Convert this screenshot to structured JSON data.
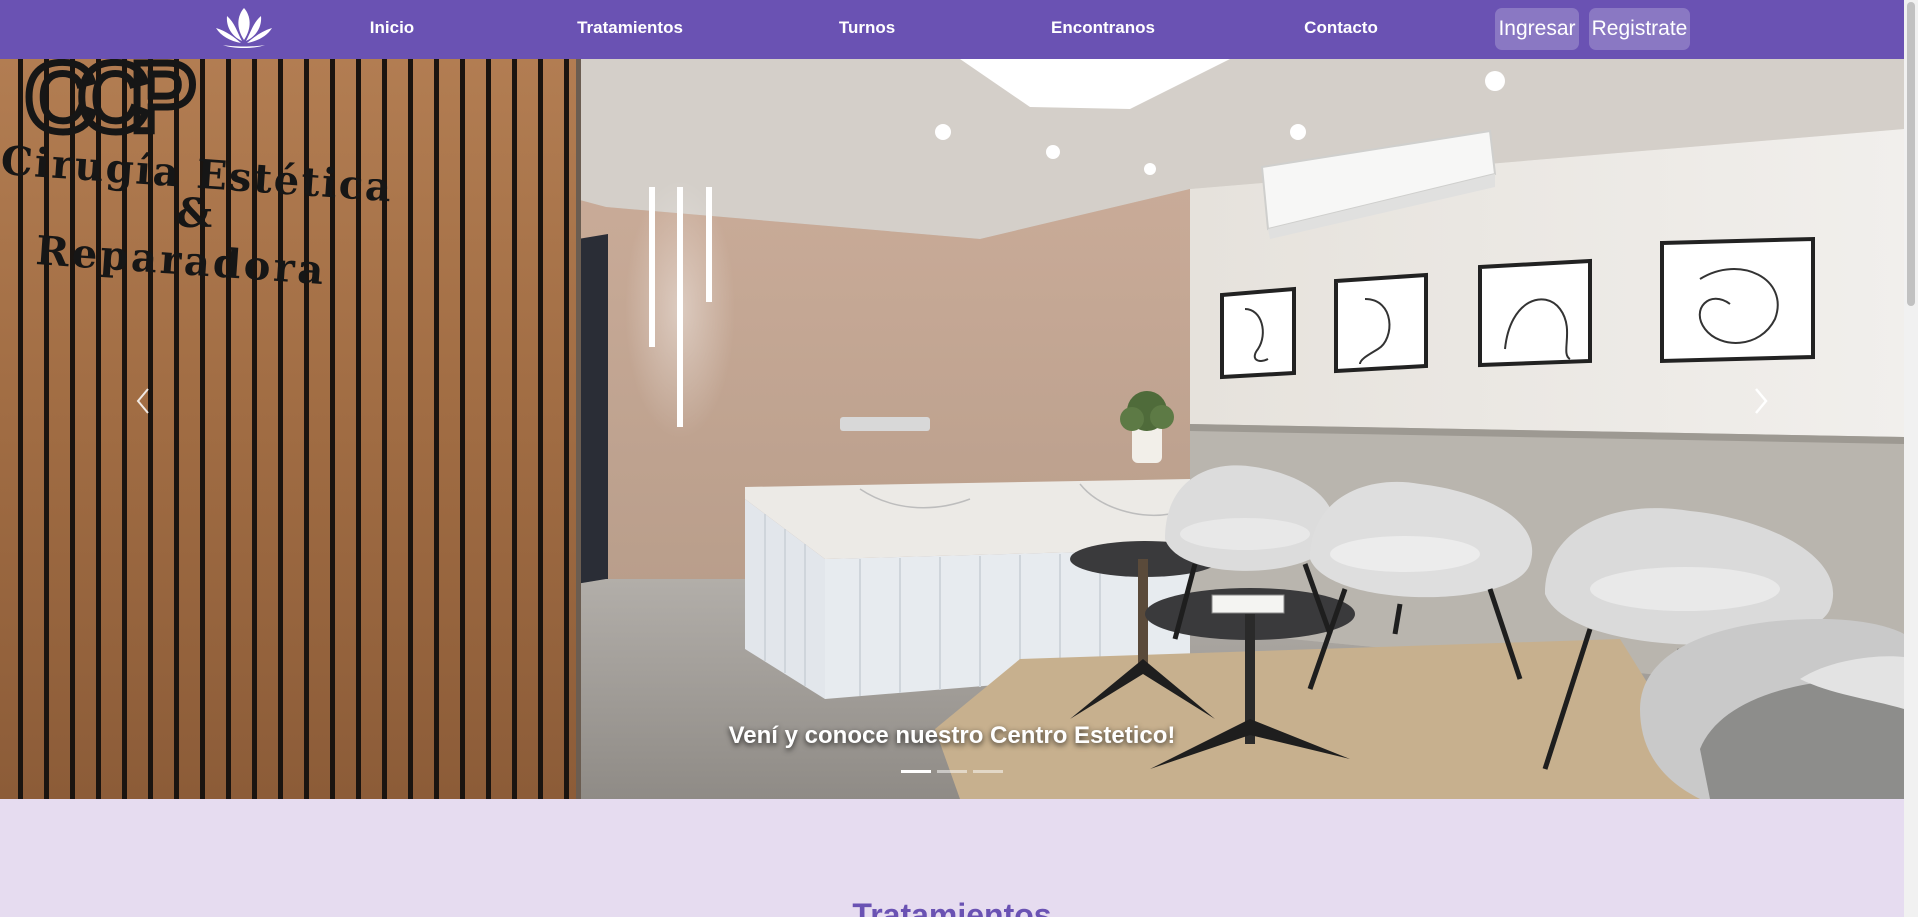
{
  "navbar": {
    "logo_icon": "lotus-icon",
    "background": "#6a52b3",
    "links": [
      {
        "label": "Inicio"
      },
      {
        "label": "Tratamientos"
      },
      {
        "label": "Turnos"
      },
      {
        "label": "Encontranos"
      },
      {
        "label": "Contacto"
      }
    ],
    "login_label": "Ingresar",
    "register_label": "Registrate"
  },
  "carousel": {
    "sign_logo": "CCP",
    "sign_line1": "Cirugía Estética",
    "sign_line2": "&",
    "sign_line3": "Reparadora",
    "caption": "Vení y conoce nuestro Centro Estetico!",
    "prev_icon": "chevron-left-icon",
    "next_icon": "chevron-right-icon",
    "slides": 3,
    "active_slide": 1
  },
  "treatments": {
    "title": "Tratamientos",
    "background": "#e6dcf0"
  }
}
